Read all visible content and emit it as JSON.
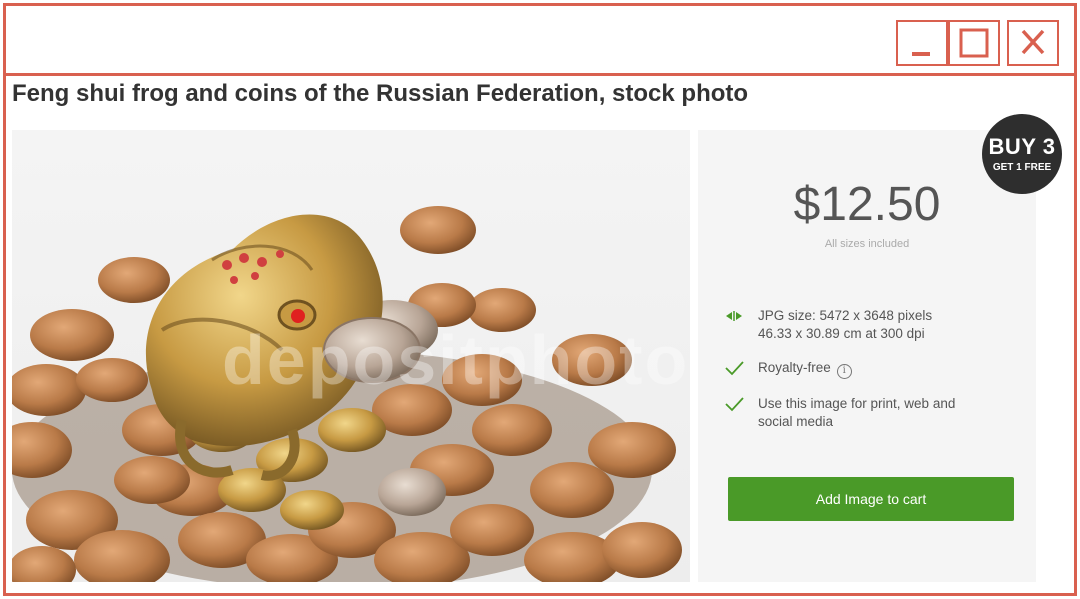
{
  "window": {
    "controls": [
      "minimize",
      "maximize",
      "close"
    ]
  },
  "page": {
    "title": "Feng shui frog and coins of the Russian Federation, stock photo"
  },
  "photo": {
    "watermark": "depositphotos"
  },
  "product": {
    "badge_line1": "BUY 3",
    "badge_line2": "GET 1 FREE",
    "price": "$12.50",
    "price_note": "All sizes included",
    "jpg_size_line1": "JPG size: 5472 x 3648 pixels",
    "jpg_size_line2": "46.33 x 30.89 cm at 300 dpi",
    "royalty": "Royalty-free",
    "info_glyph": "i",
    "usage_line1": "Use this image for print, web and",
    "usage_line2": "social media",
    "cart_label": "Add Image to cart"
  },
  "colors": {
    "frame": "#d9604f",
    "accent_green": "#4a9a28",
    "badge_bg": "#2e2e2e"
  },
  "icons": {
    "size": "resize-arrows-icon",
    "check": "checkmark-icon",
    "info": "info-icon"
  }
}
